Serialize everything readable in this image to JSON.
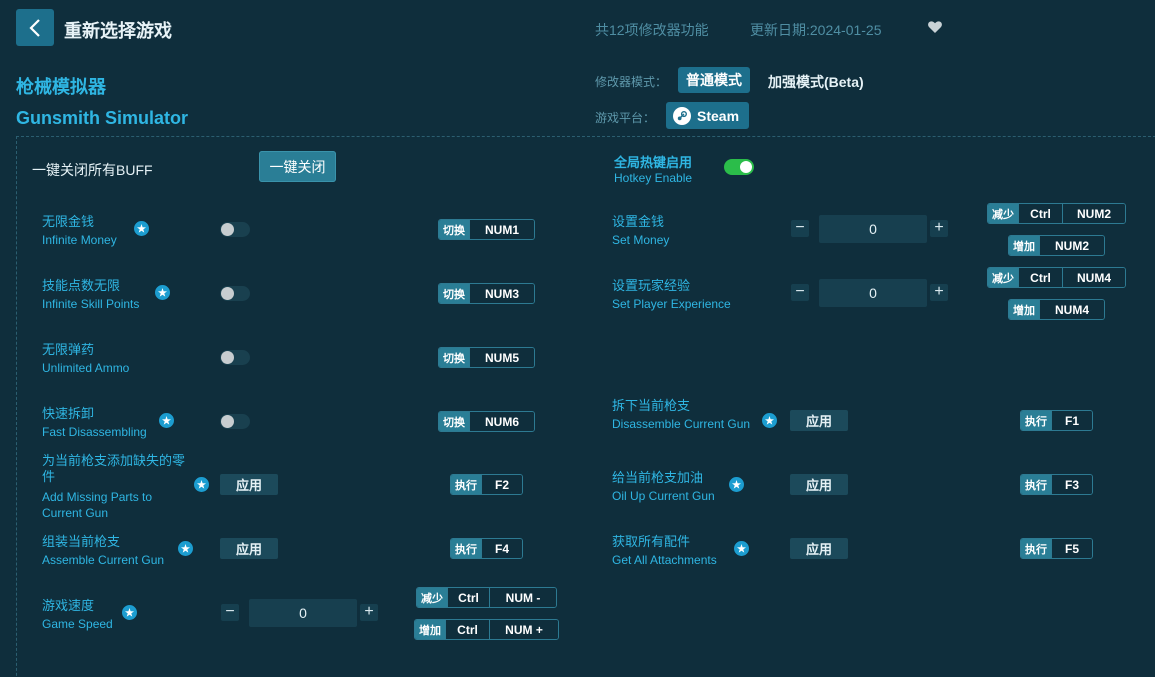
{
  "header": {
    "title": "重新选择游戏",
    "feature_count": "共12项修改器功能",
    "update_date": "更新日期:2024-01-25"
  },
  "game": {
    "name_cn": "枪械模拟器",
    "name_en": "Gunsmith Simulator"
  },
  "mode": {
    "label": "修改器模式：",
    "normal": "普通模式",
    "enhanced": "加强模式(Beta)"
  },
  "platform": {
    "label": "游戏平台：",
    "name": "Steam"
  },
  "global": {
    "all_off_label": "一键关闭所有BUFF",
    "all_off_button": "一键关闭",
    "hotkey_cn": "全局热键启用",
    "hotkey_en": "Hotkey Enable",
    "hotkey_enabled": true
  },
  "features": [
    {
      "cn": "无限金钱",
      "en": "Infinite Money",
      "action": "切换",
      "key": "NUM1",
      "enabled": false
    },
    {
      "cn": "技能点数无限",
      "en": "Infinite Skill Points",
      "action": "切换",
      "key": "NUM3",
      "enabled": false
    },
    {
      "cn": "无限弹药",
      "en": "Unlimited Ammo",
      "action": "切换",
      "key": "NUM5",
      "enabled": false
    },
    {
      "cn": "快速拆卸",
      "en": "Fast Disassembling",
      "action": "切换",
      "key": "NUM6",
      "enabled": false
    },
    {
      "cn": "为当前枪支添加缺失的零件",
      "en": "Add Missing Parts to Current Gun",
      "button": "应用",
      "action": "执行",
      "key": "F2"
    },
    {
      "cn": "组装当前枪支",
      "en": "Assemble Current Gun",
      "button": "应用",
      "action": "执行",
      "key": "F4"
    },
    {
      "cn": "游戏速度",
      "en": "Game Speed",
      "value": "0",
      "dec_action": "减少",
      "dec_mod": "Ctrl",
      "dec_key": "NUM -",
      "inc_action": "增加",
      "inc_mod": "Ctrl",
      "inc_key": "NUM +"
    },
    {
      "cn": "设置金钱",
      "en": "Set Money",
      "value": "0",
      "dec_action": "减少",
      "dec_mod": "Ctrl",
      "dec_key": "NUM2",
      "inc_action": "增加",
      "inc_key": "NUM2"
    },
    {
      "cn": "设置玩家经验",
      "en": "Set Player Experience",
      "value": "0",
      "dec_action": "减少",
      "dec_mod": "Ctrl",
      "dec_key": "NUM4",
      "inc_action": "增加",
      "inc_key": "NUM4"
    },
    {
      "cn": "拆下当前枪支",
      "en": "Disassemble Current Gun",
      "button": "应用",
      "action": "执行",
      "key": "F1"
    },
    {
      "cn": "给当前枪支加油",
      "en": "Oil Up Current Gun",
      "button": "应用",
      "action": "执行",
      "key": "F3"
    },
    {
      "cn": "获取所有配件",
      "en": "Get All Attachments",
      "button": "应用",
      "action": "执行",
      "key": "F5"
    }
  ],
  "colors": {
    "background": "#0f2e3c",
    "accent": "#2fb6e3",
    "button": "#1d6f8c",
    "toggle_on": "#2bbd4a"
  }
}
